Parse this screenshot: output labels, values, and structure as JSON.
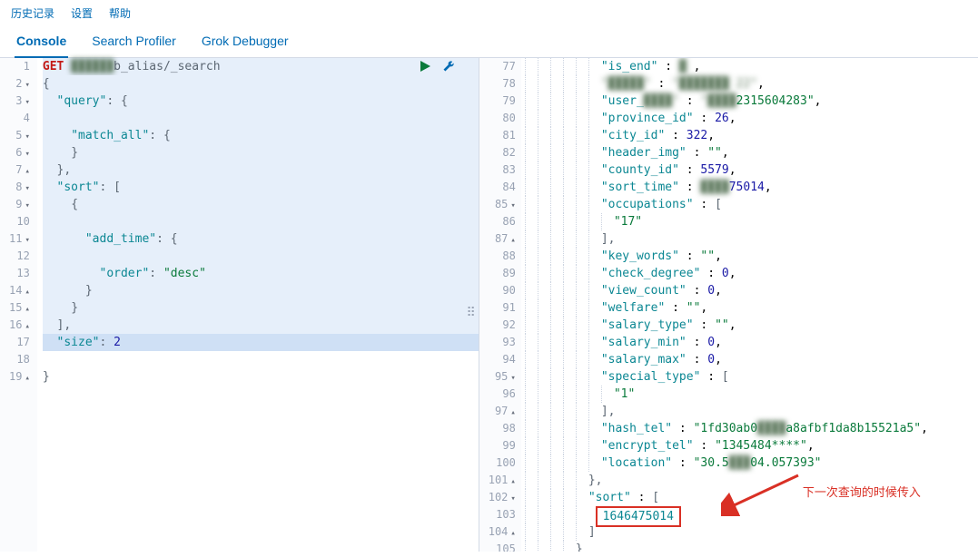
{
  "top_menu": {
    "history": "历史记录",
    "settings": "设置",
    "help": "帮助"
  },
  "tabs": {
    "console": "Console",
    "search_profiler": "Search Profiler",
    "grok_debugger": "Grok Debugger"
  },
  "left": {
    "method": "GET",
    "endpoint_blur": "██████",
    "endpoint_mid": "b_alias/_search",
    "lines": {
      "l1_num": "1",
      "l2_num": "2",
      "l3_num": "3",
      "l4_num": "4",
      "l5_num": "5",
      "l6_num": "6",
      "l7_num": "7",
      "l8_num": "8",
      "l9_num": "9",
      "l10_num": "10",
      "l11_num": "11",
      "l12_num": "12",
      "l13_num": "13",
      "l14_num": "14",
      "l15_num": "15",
      "l16_num": "16",
      "l17_num": "17",
      "l18_num": "18",
      "l19_num": "19"
    },
    "tokens": {
      "open_brace": "{",
      "query_key": "\"query\"",
      "colon": ": ",
      "match_all": "\"match_all\"",
      "close_brace": "}",
      "comma": ",",
      "sort_key": "\"sort\"",
      "open_bracket": "[",
      "close_bracket": "]",
      "add_time": "\"add_time\"",
      "order": "\"order\"",
      "desc": "\"desc\"",
      "size": "\"size\"",
      "size_val": "2"
    }
  },
  "right": {
    "gutter": [
      "77",
      "78",
      "79",
      "80",
      "81",
      "82",
      "83",
      "84",
      "85",
      "86",
      "87",
      "88",
      "89",
      "90",
      "91",
      "92",
      "93",
      "94",
      "95",
      "96",
      "97",
      "98",
      "99",
      "100",
      "101",
      "102",
      "103",
      "104",
      "105"
    ],
    "rows": {
      "r77": {
        "key": "\"is_end\"",
        "val_blur": "█"
      },
      "r78": {
        "key_blur": "\"█████\"",
        "val_blur": "\"███████ 22\""
      },
      "r79": {
        "key": "\"user_",
        "key_blur": "████\"",
        "val_blur": "\"████",
        "val_tail": "2315604283\""
      },
      "r80": {
        "key": "\"province_id\"",
        "val": "26"
      },
      "r81": {
        "key": "\"city_id\"",
        "val": "322"
      },
      "r82": {
        "key": "\"header_img\"",
        "val": "\"\""
      },
      "r83": {
        "key": "\"county_id\"",
        "val": "5579"
      },
      "r84": {
        "key": "\"sort_time\"",
        "val_blur": "████",
        "val_tail": "75014"
      },
      "r85": {
        "key": "\"occupations\"",
        "val": "["
      },
      "r86": {
        "val": "\"17\""
      },
      "r87": {
        "val": "],"
      },
      "r88": {
        "key": "\"key_words\"",
        "val": "\"\""
      },
      "r89": {
        "key": "\"check_degree\"",
        "val": "0"
      },
      "r90": {
        "key": "\"view_count\"",
        "val": "0"
      },
      "r91": {
        "key": "\"welfare\"",
        "val": "\"\""
      },
      "r92": {
        "key": "\"salary_type\"",
        "val": "\"\""
      },
      "r93": {
        "key": "\"salary_min\"",
        "val": "0"
      },
      "r94": {
        "key": "\"salary_max\"",
        "val": "0"
      },
      "r95": {
        "key": "\"special_type\"",
        "val": "["
      },
      "r96": {
        "val": "\"1\""
      },
      "r97": {
        "val": "],"
      },
      "r98": {
        "key": "\"hash_tel\"",
        "val_head": "\"1fd30ab0",
        "val_blur": "████",
        "val_tail": "a8afbf1da8b15521a5\""
      },
      "r99": {
        "key": "\"encrypt_tel\"",
        "val": "\"1345484****\""
      },
      "r100": {
        "key": "\"location\"",
        "val_head": "\"30.5",
        "val_blur": "███",
        "val_tail": "04.057393\""
      },
      "r101": {
        "val": "},"
      },
      "r102": {
        "key": "\"sort\"",
        "val": "["
      },
      "r103": {
        "val": "1646475014"
      },
      "r104": {
        "val": "]"
      },
      "r105": {
        "val": "}"
      }
    }
  },
  "annotation": {
    "text": "下一次查询的时候传入"
  }
}
